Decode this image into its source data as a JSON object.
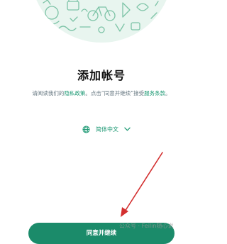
{
  "page": {
    "title": "添加帐号",
    "description": {
      "part1": "请阅读我们的",
      "privacy_link": "隐私政策",
      "part2": "。点击“同意并继续”接受",
      "terms_link": "服务条款",
      "part3": "。"
    },
    "language": {
      "selected": "简体中文",
      "globe_icon": "globe-icon",
      "dropdown_icon": "chevron-down-icon"
    },
    "continue_button": "同意并继续",
    "watermark": "公众号 · Feilin随心说"
  },
  "colors": {
    "accent": "#1f9a75",
    "button": "#1b8b6a",
    "title": "#111111",
    "body_text": "#667781",
    "hero_bg": "#e8f5ef",
    "annotation_arrow": "#d32f2f"
  }
}
